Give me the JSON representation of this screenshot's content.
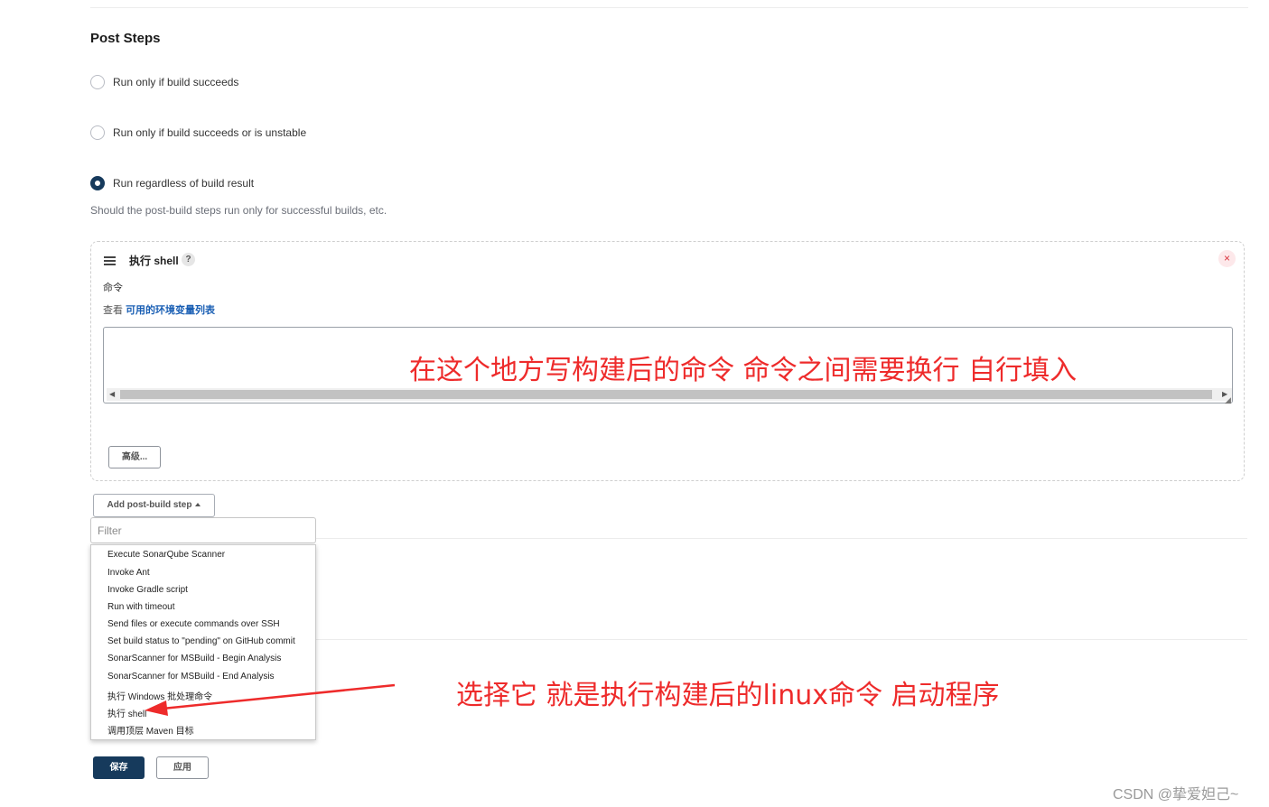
{
  "post_steps": {
    "title": "Post Steps",
    "options": [
      {
        "label": "Run only if build succeeds",
        "checked": false
      },
      {
        "label": "Run only if build succeeds or is unstable",
        "checked": false
      },
      {
        "label": "Run regardless of build result",
        "checked": true
      }
    ],
    "help": "Should the post-build steps run only for successful builds, etc."
  },
  "shell_step": {
    "title": "执行 shell",
    "help_glyph": "?",
    "close_glyph": "×",
    "command_label": "命令",
    "env_prefix": "查看",
    "env_link": "可用的环境变量列表",
    "command_value": "",
    "advanced_label": "高级..."
  },
  "add_step": {
    "button_label": "Add post-build step",
    "filter_placeholder": "Filter",
    "items": [
      "Execute SonarQube Scanner",
      "Invoke Ant",
      "Invoke Gradle script",
      "Run with timeout",
      "Send files or execute commands over SSH",
      "Set build status to \"pending\" on GitHub commit",
      "SonarScanner for MSBuild - Begin Analysis",
      "SonarScanner for MSBuild - End Analysis",
      "执行 Windows 批处理命令",
      "执行 shell",
      "调用顶层 Maven 目标"
    ]
  },
  "annotations": {
    "command_hint": "在这个地方写构建后的命令 命令之间需要换行 自行填入",
    "select_hint": "选择它  就是执行构建后的linux命令 启动程序",
    "color": "#ee2b2b"
  },
  "footer": {
    "save_label": "保存",
    "apply_label": "应用"
  },
  "watermark": "CSDN @挚爱妲己~",
  "colors": {
    "primary": "#163a5c",
    "link": "#1a5fb4",
    "close": "#d9323c"
  }
}
